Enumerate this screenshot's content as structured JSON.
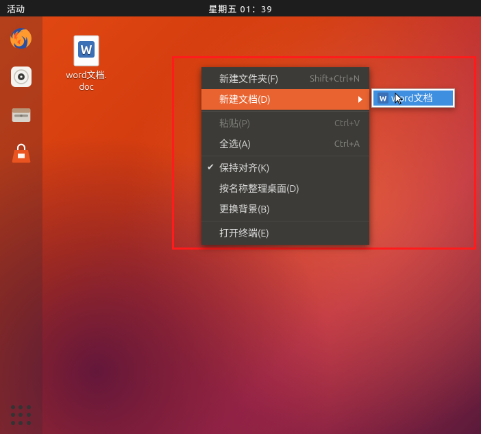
{
  "topbar": {
    "activities": "活动",
    "clock": "星期五 01：39"
  },
  "desktop_icons": [
    {
      "name": "word文档.\ndoc"
    }
  ],
  "context_menu": {
    "items": [
      {
        "label": "新建文件夹(F)",
        "shortcut": "Shift+Ctrl+N",
        "state": "normal"
      },
      {
        "label": "新建文档(D)",
        "shortcut": "",
        "state": "active-submenu"
      },
      {
        "separator": true
      },
      {
        "label": "粘贴(P)",
        "shortcut": "Ctrl+V",
        "state": "disabled"
      },
      {
        "label": "全选(A)",
        "shortcut": "Ctrl+A",
        "state": "normal"
      },
      {
        "separator": true
      },
      {
        "label": "保持对齐(K)",
        "shortcut": "",
        "state": "checked"
      },
      {
        "label": "按名称整理桌面(D)",
        "shortcut": "",
        "state": "normal"
      },
      {
        "label": "更换背景(B)",
        "shortcut": "",
        "state": "normal"
      },
      {
        "separator": true
      },
      {
        "label": "打开终端(E)",
        "shortcut": "",
        "state": "normal"
      }
    ]
  },
  "submenu": {
    "item": "word文档"
  },
  "dock_items": [
    {
      "name": "firefox"
    },
    {
      "name": "rhythmbox"
    },
    {
      "name": "files"
    },
    {
      "name": "software"
    }
  ]
}
